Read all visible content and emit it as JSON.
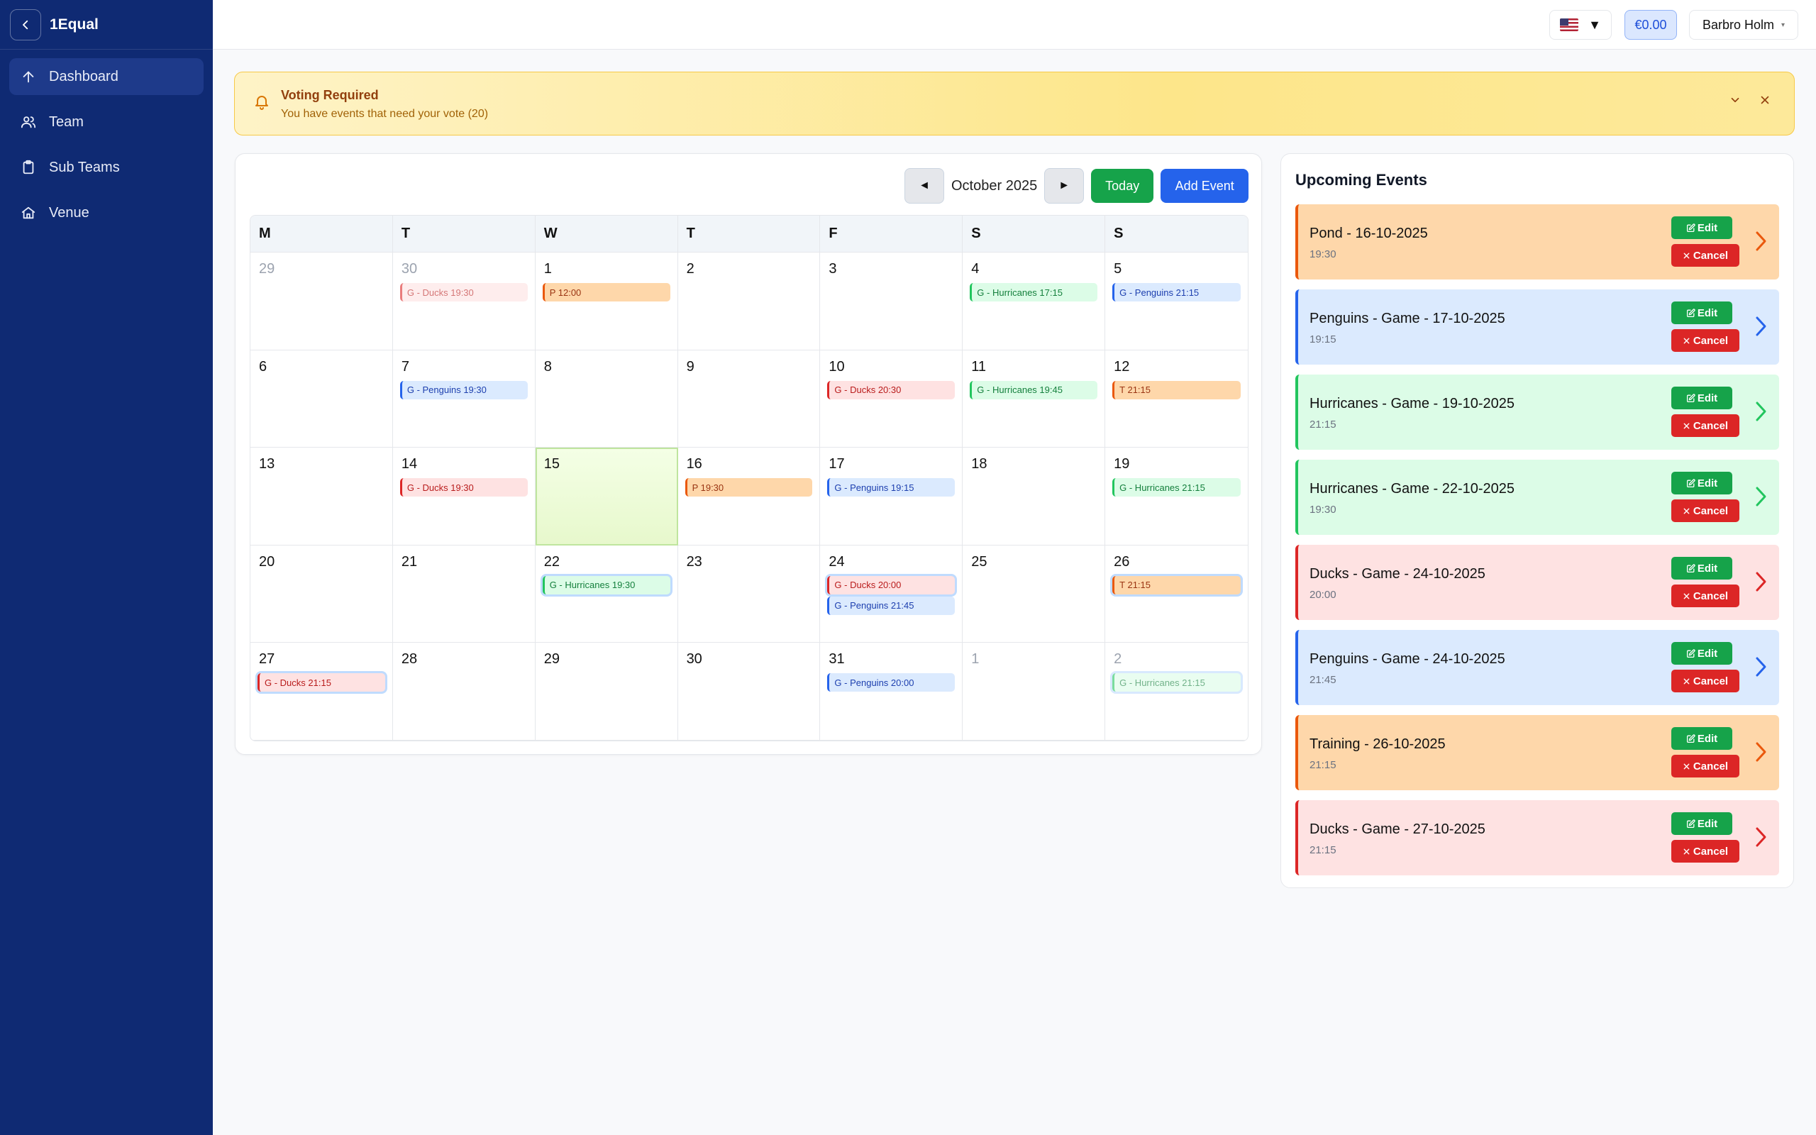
{
  "app": {
    "name": "1Equal"
  },
  "sidebar": {
    "items": [
      {
        "label": "Dashboard",
        "icon": "arrow-up-icon",
        "active": true
      },
      {
        "label": "Team",
        "icon": "users-icon"
      },
      {
        "label": "Sub Teams",
        "icon": "clipboard-icon"
      },
      {
        "label": "Venue",
        "icon": "home-icon"
      }
    ]
  },
  "topbar": {
    "lang_caret": "▼",
    "balance": "€0.00",
    "user": "Barbro Holm",
    "user_caret": "▾"
  },
  "alert": {
    "title": "Voting Required",
    "text": "You have events that need your vote (20)"
  },
  "calendar": {
    "month": "October 2025",
    "prev": "◄",
    "next": "►",
    "today": "Today",
    "add": "Add Event",
    "weekdays": [
      "M",
      "T",
      "W",
      "T",
      "F",
      "S",
      "S"
    ],
    "weeks": [
      [
        {
          "d": "29",
          "o": true,
          "ev": []
        },
        {
          "d": "30",
          "o": true,
          "ev": [
            {
              "t": "G - Ducks 19:30",
              "c": "red",
              "f": true
            }
          ]
        },
        {
          "d": "1",
          "ev": [
            {
              "t": "P 12:00",
              "c": "orange"
            }
          ]
        },
        {
          "d": "2",
          "ev": []
        },
        {
          "d": "3",
          "ev": []
        },
        {
          "d": "4",
          "ev": [
            {
              "t": "G - Hurricanes 17:15",
              "c": "green"
            }
          ]
        },
        {
          "d": "5",
          "ev": [
            {
              "t": "G - Penguins 21:15",
              "c": "blue"
            }
          ]
        }
      ],
      [
        {
          "d": "6",
          "ev": []
        },
        {
          "d": "7",
          "ev": [
            {
              "t": "G - Penguins 19:30",
              "c": "blue"
            }
          ]
        },
        {
          "d": "8",
          "ev": []
        },
        {
          "d": "9",
          "ev": []
        },
        {
          "d": "10",
          "ev": [
            {
              "t": "G - Ducks 20:30",
              "c": "red"
            }
          ]
        },
        {
          "d": "11",
          "ev": [
            {
              "t": "G - Hurricanes 19:45",
              "c": "green"
            }
          ]
        },
        {
          "d": "12",
          "ev": [
            {
              "t": "T 21:15",
              "c": "orange"
            }
          ]
        }
      ],
      [
        {
          "d": "13",
          "ev": []
        },
        {
          "d": "14",
          "ev": [
            {
              "t": "G - Ducks 19:30",
              "c": "red"
            }
          ]
        },
        {
          "d": "15",
          "today": true,
          "ev": []
        },
        {
          "d": "16",
          "ev": [
            {
              "t": "P 19:30",
              "c": "orange"
            }
          ]
        },
        {
          "d": "17",
          "ev": [
            {
              "t": "G - Penguins 19:15",
              "c": "blue"
            }
          ]
        },
        {
          "d": "18",
          "ev": []
        },
        {
          "d": "19",
          "ev": [
            {
              "t": "G - Hurricanes 21:15",
              "c": "green"
            }
          ]
        }
      ],
      [
        {
          "d": "20",
          "ev": []
        },
        {
          "d": "21",
          "ev": []
        },
        {
          "d": "22",
          "ev": [
            {
              "t": "G - Hurricanes 19:30",
              "c": "green",
              "s": true
            }
          ]
        },
        {
          "d": "23",
          "ev": []
        },
        {
          "d": "24",
          "ev": [
            {
              "t": "G - Ducks 20:00",
              "c": "red",
              "s": true
            },
            {
              "t": "G - Penguins 21:45",
              "c": "blue"
            }
          ]
        },
        {
          "d": "25",
          "ev": []
        },
        {
          "d": "26",
          "ev": [
            {
              "t": "T 21:15",
              "c": "orange",
              "s": true
            }
          ]
        }
      ],
      [
        {
          "d": "27",
          "ev": [
            {
              "t": "G - Ducks 21:15",
              "c": "red",
              "s": true
            }
          ]
        },
        {
          "d": "28",
          "ev": []
        },
        {
          "d": "29",
          "ev": []
        },
        {
          "d": "30",
          "ev": []
        },
        {
          "d": "31",
          "ev": [
            {
              "t": "G - Penguins 20:00",
              "c": "blue"
            }
          ]
        },
        {
          "d": "1",
          "o": true,
          "ev": []
        },
        {
          "d": "2",
          "o": true,
          "ev": [
            {
              "t": "G - Hurricanes 21:15",
              "c": "green",
              "f": true,
              "s": true
            }
          ]
        }
      ]
    ]
  },
  "upcoming": {
    "title": "Upcoming Events",
    "edit": "Edit",
    "cancel": "Cancel",
    "items": [
      {
        "name": "Pond - 16-10-2025",
        "time": "19:30",
        "color": "orange"
      },
      {
        "name": "Penguins - Game - 17-10-2025",
        "time": "19:15",
        "color": "blue"
      },
      {
        "name": "Hurricanes - Game - 19-10-2025",
        "time": "21:15",
        "color": "green"
      },
      {
        "name": "Hurricanes - Game - 22-10-2025",
        "time": "19:30",
        "color": "green"
      },
      {
        "name": "Ducks - Game - 24-10-2025",
        "time": "20:00",
        "color": "red"
      },
      {
        "name": "Penguins - Game - 24-10-2025",
        "time": "21:45",
        "color": "blue"
      },
      {
        "name": "Training - 26-10-2025",
        "time": "21:15",
        "color": "orange"
      },
      {
        "name": "Ducks - Game - 27-10-2025",
        "time": "21:15",
        "color": "red"
      }
    ]
  },
  "colors": {
    "sidebar": "#0f2a73",
    "orange": "#ea580c",
    "blue": "#2563eb",
    "green": "#22c55e",
    "red": "#dc2626"
  }
}
